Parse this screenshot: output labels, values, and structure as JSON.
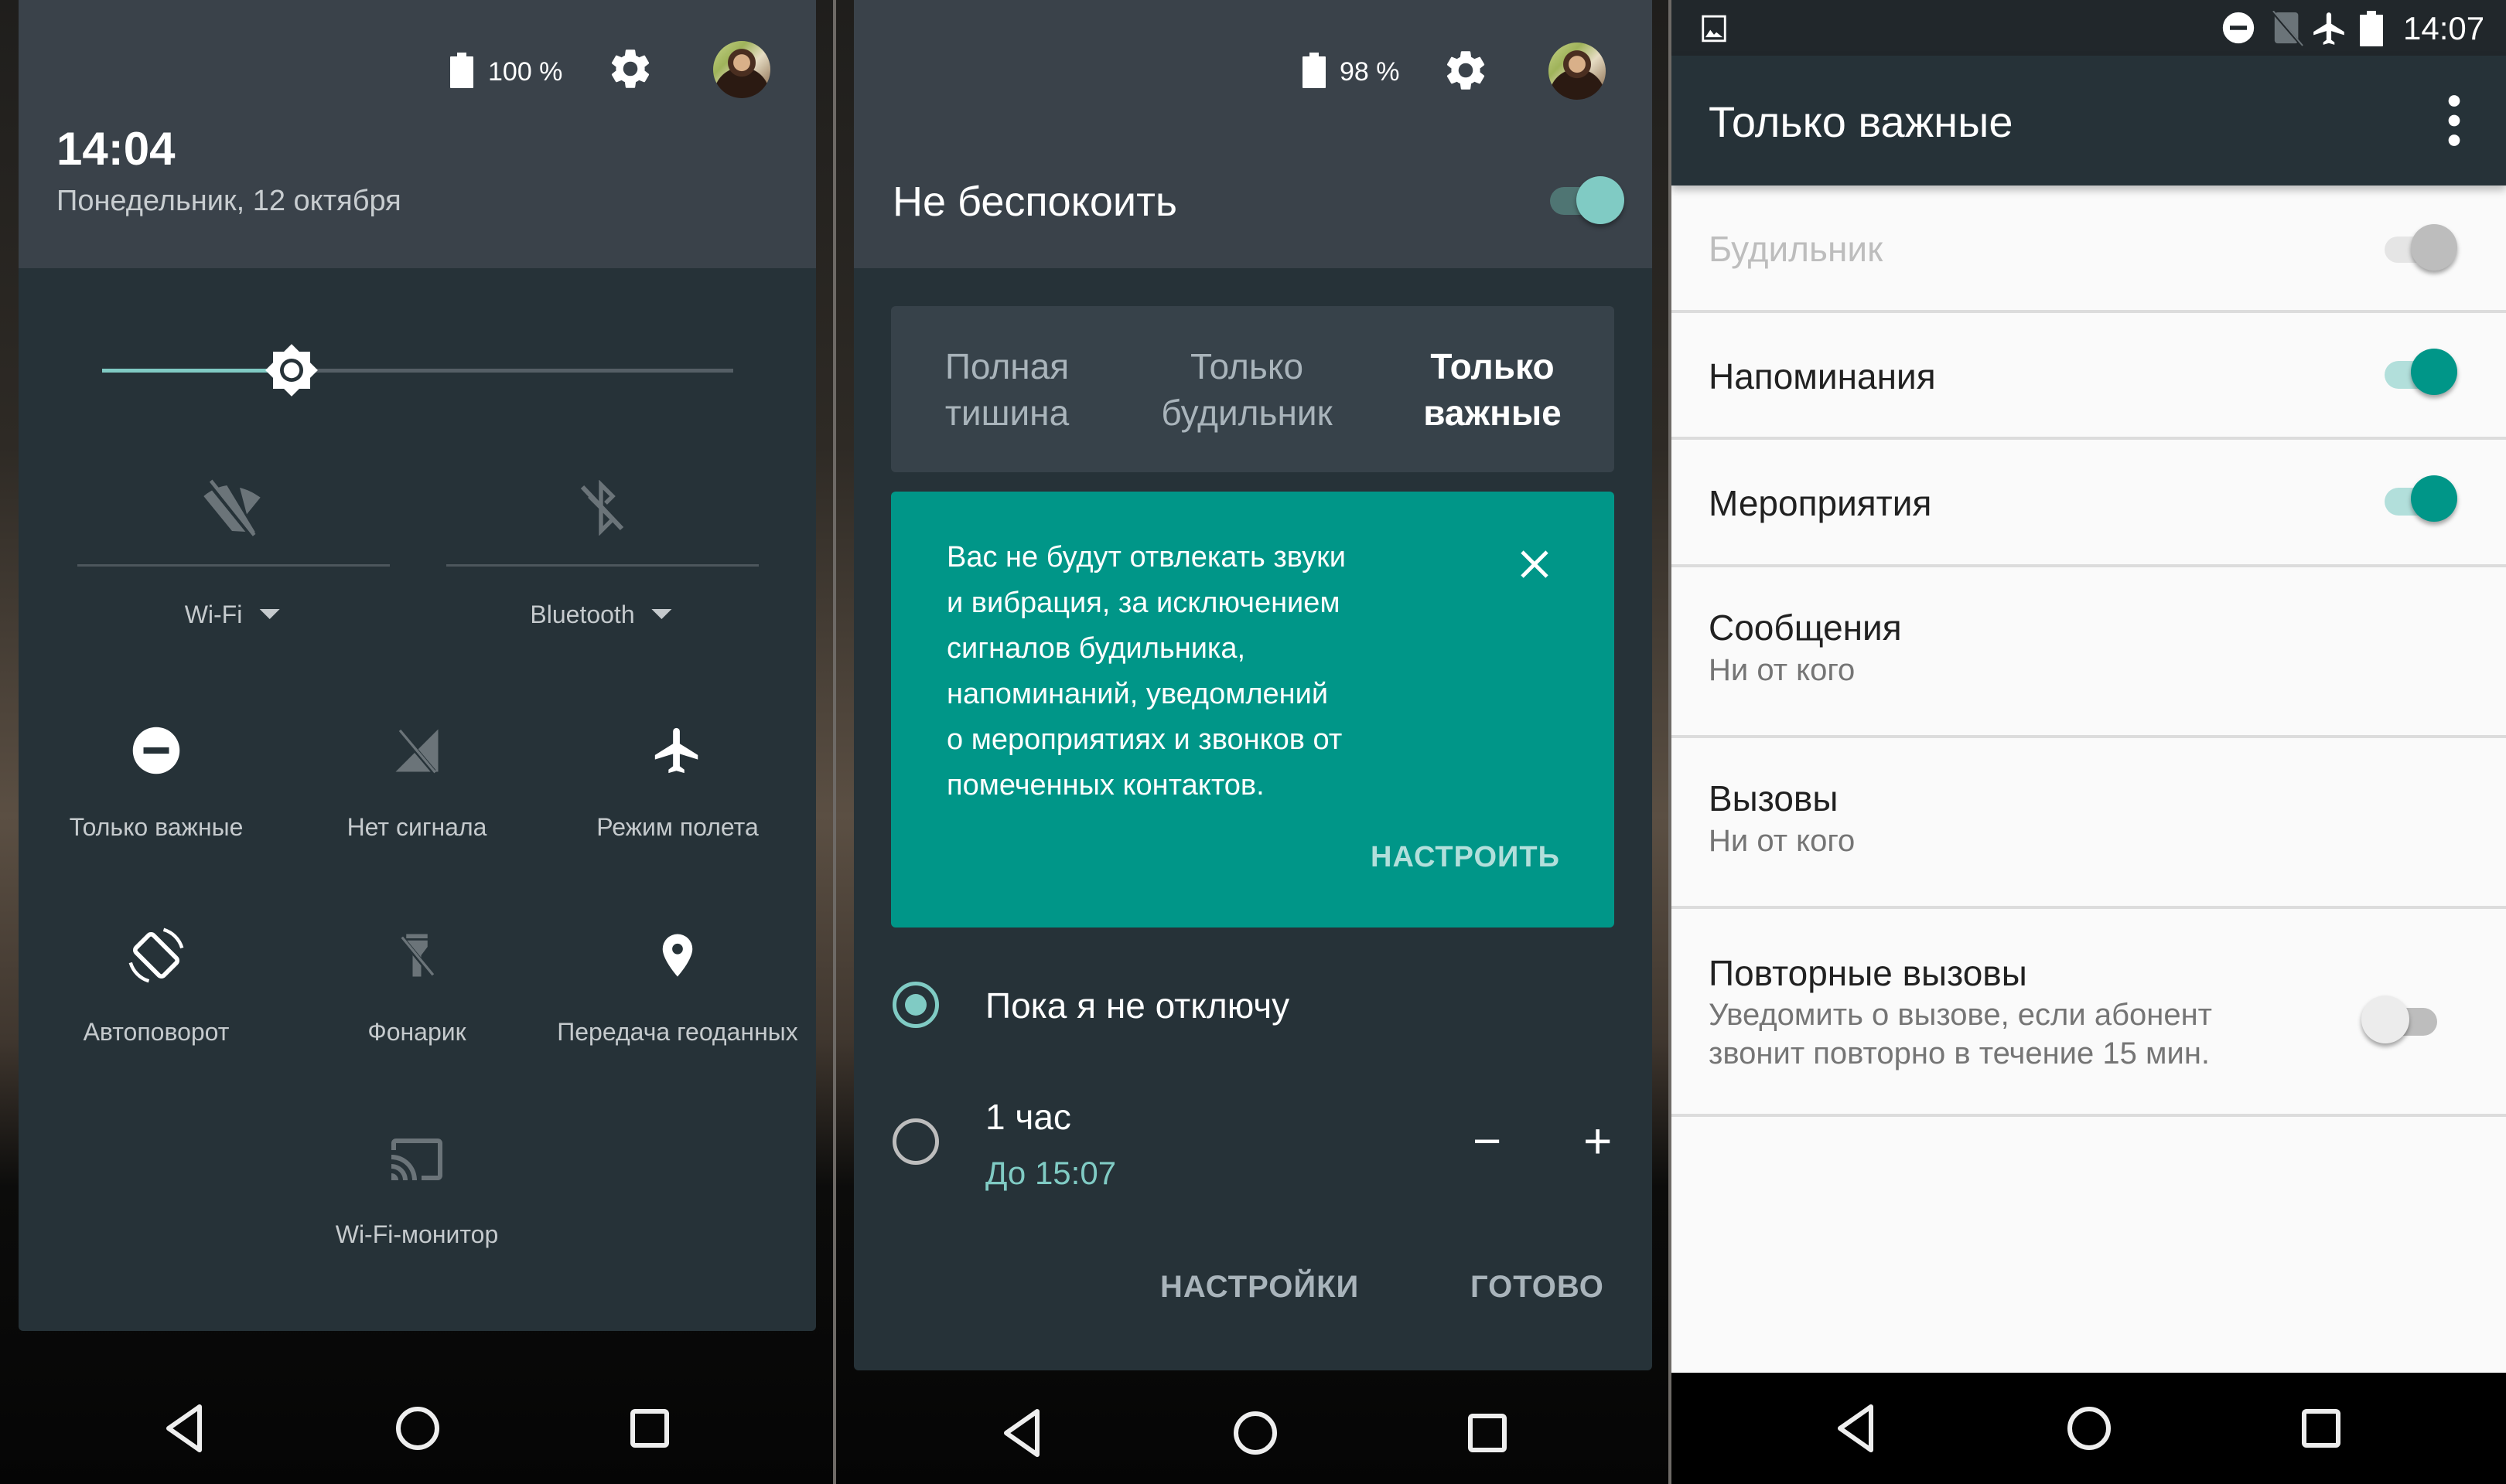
{
  "colors": {
    "accent_teal": "#009688",
    "accent_teal_light": "#80cbc4",
    "shade_header": "#3a424a",
    "shade_body": "#263238",
    "list_background": "#fafafa"
  },
  "panel1": {
    "header": {
      "battery_icon": "battery-full-icon",
      "battery_text": "100 %",
      "settings_icon": "gear-icon",
      "avatar": "user-avatar",
      "time": "14:04",
      "date": "Понедельник, 12 октября"
    },
    "brightness": {
      "icon": "brightness-icon",
      "level_fraction": 0.3
    },
    "wide_tiles": [
      {
        "id": "wifi",
        "icon": "wifi-off-icon",
        "label": "Wi-Fi",
        "has_dropdown": true,
        "active": false
      },
      {
        "id": "bluetooth",
        "icon": "bluetooth-off-icon",
        "label": "Bluetooth",
        "has_dropdown": true,
        "active": false
      }
    ],
    "tiles": [
      {
        "id": "priority",
        "icon": "do-not-disturb-icon",
        "label": "Только важные",
        "active": true
      },
      {
        "id": "signal",
        "icon": "no-signal-icon",
        "label": "Нет сигнала",
        "active": false
      },
      {
        "id": "airplane",
        "icon": "airplane-icon",
        "label": "Режим полета",
        "active": true
      },
      {
        "id": "rotate",
        "icon": "auto-rotate-icon",
        "label": "Автоповорот",
        "active": true
      },
      {
        "id": "flashlight",
        "icon": "flashlight-off-icon",
        "label": "Фонарик",
        "active": false
      },
      {
        "id": "location",
        "icon": "location-pin-icon",
        "label": "Передача геоданных",
        "active": true
      },
      {
        "id": "cast",
        "icon": "cast-icon",
        "label": "Wi-Fi-монитор",
        "active": false
      }
    ]
  },
  "panel2": {
    "header": {
      "battery_text": "98 %",
      "title": "Не беспокоить",
      "toggle_on": true
    },
    "modes": [
      {
        "label": "Полная\nтишина",
        "selected": false
      },
      {
        "label": "Только\nбудильник",
        "selected": false
      },
      {
        "label": "Только\nважные",
        "selected": true
      }
    ],
    "info_card": {
      "text": "Вас не будут отвлекать звуки\nи вибрация, за исключением\nсигналов будильника,\nнапоминаний, уведомлений\nо мероприятиях и звонков от\nпомеченных контактов.",
      "close_icon": "close-icon",
      "action_label": "НАСТРОИТЬ"
    },
    "duration_options": [
      {
        "label": "Пока я не отключу",
        "selected": true
      },
      {
        "label": "1 час",
        "sublabel": "До 15:07",
        "selected": false,
        "decrement": "−",
        "increment": "+"
      }
    ],
    "buttons": {
      "settings": "НАСТРОЙКИ",
      "done": "ГОТОВО"
    }
  },
  "panel3": {
    "status_bar": {
      "notification_icon": "image-icon",
      "icons": [
        "do-not-disturb-icon",
        "no-sim-icon",
        "airplane-icon",
        "battery-full-icon"
      ],
      "time": "14:07"
    },
    "app_bar": {
      "title": "Только важные",
      "menu_icon": "more-vert-icon"
    },
    "settings": [
      {
        "title": "Будильник",
        "enabled": false,
        "toggle": true,
        "checked": true
      },
      {
        "title": "Напоминания",
        "enabled": true,
        "toggle": true,
        "checked": true
      },
      {
        "title": "Мероприятия",
        "enabled": true,
        "toggle": true,
        "checked": true
      },
      {
        "title": "Сообщения",
        "subtitle": "Ни от кого",
        "enabled": true,
        "toggle": false
      },
      {
        "title": "Вызовы",
        "subtitle": "Ни от кого",
        "enabled": true,
        "toggle": false
      },
      {
        "title": "Повторные вызовы",
        "subtitle": "Уведомить о вызове, если абонент\nзвонит повторно в течение 15 мин.",
        "enabled": true,
        "toggle": true,
        "checked": false
      }
    ]
  },
  "nav_bar": {
    "back": "back-icon",
    "home": "home-icon",
    "recents": "recents-icon"
  }
}
